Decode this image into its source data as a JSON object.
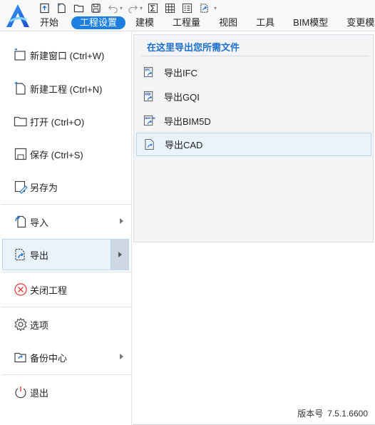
{
  "app": {
    "logo_name": "app-logo",
    "accent_color": "#1d7fe0"
  },
  "quick_access": [
    {
      "name": "save-up-icon"
    },
    {
      "name": "new-file-icon"
    },
    {
      "name": "open-folder-icon"
    },
    {
      "name": "save-icon"
    },
    {
      "name": "undo-icon"
    },
    {
      "name": "redo-icon"
    },
    {
      "name": "sum-icon"
    },
    {
      "name": "grid-icon"
    },
    {
      "name": "list-icon"
    },
    {
      "name": "export-icon"
    }
  ],
  "tabs": [
    {
      "label": "开始",
      "active": false
    },
    {
      "label": "工程设置",
      "active": true
    },
    {
      "label": "建模",
      "active": false
    },
    {
      "label": "工程量",
      "active": false
    },
    {
      "label": "视图",
      "active": false
    },
    {
      "label": "工具",
      "active": false
    },
    {
      "label": "BIM模型",
      "active": false
    },
    {
      "label": "变更模块",
      "active": false
    }
  ],
  "menu": {
    "new_window": "新建窗口 (Ctrl+W)",
    "new_project": "新建工程 (Ctrl+N)",
    "open": "打开 (Ctrl+O)",
    "save": "保存 (Ctrl+S)",
    "save_as": "另存为",
    "import": "导入",
    "export": "导出",
    "close_project": "关闭工程",
    "options": "选项",
    "backup_center": "备份中心",
    "exit": "退出"
  },
  "export_panel": {
    "title": "在这里导出您所需文件",
    "items": [
      {
        "label": "导出IFC",
        "icon": "export-ifc-icon",
        "badge": "IFC"
      },
      {
        "label": "导出GQI",
        "icon": "export-gqi-icon",
        "badge": "GQI"
      },
      {
        "label": "导出BIM5D",
        "icon": "export-bim5d-icon",
        "badge": "BIM 5D"
      },
      {
        "label": "导出CAD",
        "icon": "export-cad-icon",
        "badge": ""
      }
    ]
  },
  "version": {
    "label": "版本号",
    "number": "7.5.1.6600"
  }
}
